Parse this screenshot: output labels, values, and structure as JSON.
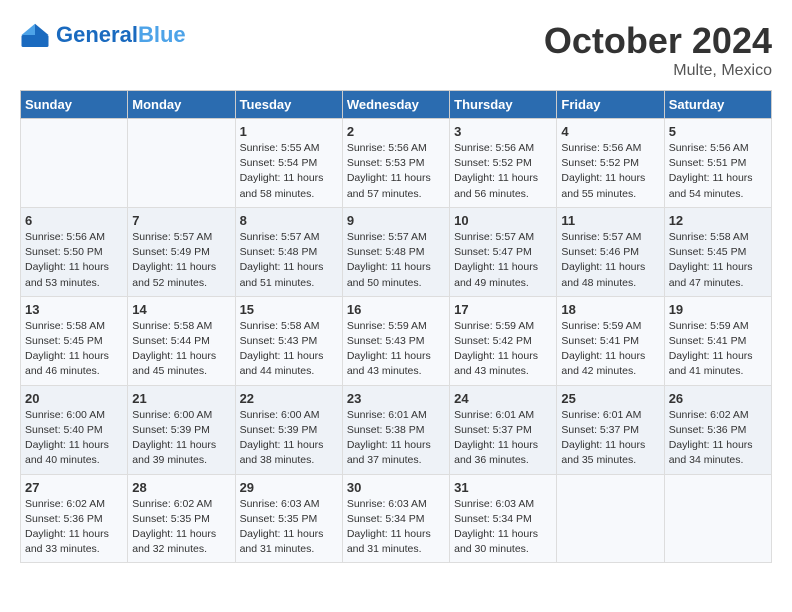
{
  "header": {
    "logo_general": "General",
    "logo_blue": "Blue",
    "month": "October 2024",
    "location": "Multe, Mexico"
  },
  "weekdays": [
    "Sunday",
    "Monday",
    "Tuesday",
    "Wednesday",
    "Thursday",
    "Friday",
    "Saturday"
  ],
  "weeks": [
    [
      {
        "day": "",
        "info": ""
      },
      {
        "day": "",
        "info": ""
      },
      {
        "day": "1",
        "info": "Sunrise: 5:55 AM\nSunset: 5:54 PM\nDaylight: 11 hours and 58 minutes."
      },
      {
        "day": "2",
        "info": "Sunrise: 5:56 AM\nSunset: 5:53 PM\nDaylight: 11 hours and 57 minutes."
      },
      {
        "day": "3",
        "info": "Sunrise: 5:56 AM\nSunset: 5:52 PM\nDaylight: 11 hours and 56 minutes."
      },
      {
        "day": "4",
        "info": "Sunrise: 5:56 AM\nSunset: 5:52 PM\nDaylight: 11 hours and 55 minutes."
      },
      {
        "day": "5",
        "info": "Sunrise: 5:56 AM\nSunset: 5:51 PM\nDaylight: 11 hours and 54 minutes."
      }
    ],
    [
      {
        "day": "6",
        "info": "Sunrise: 5:56 AM\nSunset: 5:50 PM\nDaylight: 11 hours and 53 minutes."
      },
      {
        "day": "7",
        "info": "Sunrise: 5:57 AM\nSunset: 5:49 PM\nDaylight: 11 hours and 52 minutes."
      },
      {
        "day": "8",
        "info": "Sunrise: 5:57 AM\nSunset: 5:48 PM\nDaylight: 11 hours and 51 minutes."
      },
      {
        "day": "9",
        "info": "Sunrise: 5:57 AM\nSunset: 5:48 PM\nDaylight: 11 hours and 50 minutes."
      },
      {
        "day": "10",
        "info": "Sunrise: 5:57 AM\nSunset: 5:47 PM\nDaylight: 11 hours and 49 minutes."
      },
      {
        "day": "11",
        "info": "Sunrise: 5:57 AM\nSunset: 5:46 PM\nDaylight: 11 hours and 48 minutes."
      },
      {
        "day": "12",
        "info": "Sunrise: 5:58 AM\nSunset: 5:45 PM\nDaylight: 11 hours and 47 minutes."
      }
    ],
    [
      {
        "day": "13",
        "info": "Sunrise: 5:58 AM\nSunset: 5:45 PM\nDaylight: 11 hours and 46 minutes."
      },
      {
        "day": "14",
        "info": "Sunrise: 5:58 AM\nSunset: 5:44 PM\nDaylight: 11 hours and 45 minutes."
      },
      {
        "day": "15",
        "info": "Sunrise: 5:58 AM\nSunset: 5:43 PM\nDaylight: 11 hours and 44 minutes."
      },
      {
        "day": "16",
        "info": "Sunrise: 5:59 AM\nSunset: 5:43 PM\nDaylight: 11 hours and 43 minutes."
      },
      {
        "day": "17",
        "info": "Sunrise: 5:59 AM\nSunset: 5:42 PM\nDaylight: 11 hours and 43 minutes."
      },
      {
        "day": "18",
        "info": "Sunrise: 5:59 AM\nSunset: 5:41 PM\nDaylight: 11 hours and 42 minutes."
      },
      {
        "day": "19",
        "info": "Sunrise: 5:59 AM\nSunset: 5:41 PM\nDaylight: 11 hours and 41 minutes."
      }
    ],
    [
      {
        "day": "20",
        "info": "Sunrise: 6:00 AM\nSunset: 5:40 PM\nDaylight: 11 hours and 40 minutes."
      },
      {
        "day": "21",
        "info": "Sunrise: 6:00 AM\nSunset: 5:39 PM\nDaylight: 11 hours and 39 minutes."
      },
      {
        "day": "22",
        "info": "Sunrise: 6:00 AM\nSunset: 5:39 PM\nDaylight: 11 hours and 38 minutes."
      },
      {
        "day": "23",
        "info": "Sunrise: 6:01 AM\nSunset: 5:38 PM\nDaylight: 11 hours and 37 minutes."
      },
      {
        "day": "24",
        "info": "Sunrise: 6:01 AM\nSunset: 5:37 PM\nDaylight: 11 hours and 36 minutes."
      },
      {
        "day": "25",
        "info": "Sunrise: 6:01 AM\nSunset: 5:37 PM\nDaylight: 11 hours and 35 minutes."
      },
      {
        "day": "26",
        "info": "Sunrise: 6:02 AM\nSunset: 5:36 PM\nDaylight: 11 hours and 34 minutes."
      }
    ],
    [
      {
        "day": "27",
        "info": "Sunrise: 6:02 AM\nSunset: 5:36 PM\nDaylight: 11 hours and 33 minutes."
      },
      {
        "day": "28",
        "info": "Sunrise: 6:02 AM\nSunset: 5:35 PM\nDaylight: 11 hours and 32 minutes."
      },
      {
        "day": "29",
        "info": "Sunrise: 6:03 AM\nSunset: 5:35 PM\nDaylight: 11 hours and 31 minutes."
      },
      {
        "day": "30",
        "info": "Sunrise: 6:03 AM\nSunset: 5:34 PM\nDaylight: 11 hours and 31 minutes."
      },
      {
        "day": "31",
        "info": "Sunrise: 6:03 AM\nSunset: 5:34 PM\nDaylight: 11 hours and 30 minutes."
      },
      {
        "day": "",
        "info": ""
      },
      {
        "day": "",
        "info": ""
      }
    ]
  ]
}
